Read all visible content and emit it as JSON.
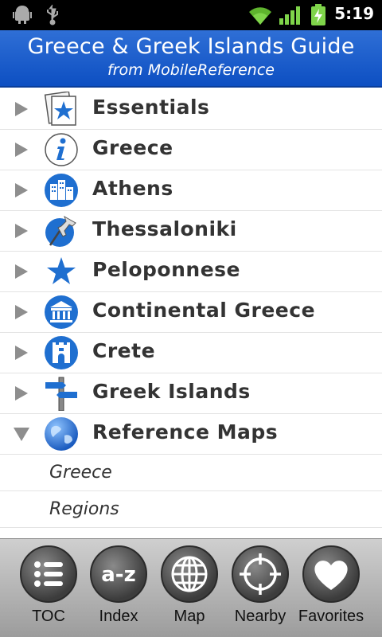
{
  "status_bar": {
    "time": "5:19",
    "icons": [
      "android-debug-icon",
      "usb-icon",
      "wifi-icon",
      "signal-icon",
      "battery-charging-icon"
    ]
  },
  "header": {
    "title": "Greece & Greek Islands Guide",
    "subtitle": "from MobileReference"
  },
  "toc": {
    "items": [
      {
        "label": "Essentials",
        "icon": "star-page-icon",
        "expanded": false
      },
      {
        "label": "Greece",
        "icon": "info-icon",
        "expanded": false
      },
      {
        "label": "Athens",
        "icon": "city-buildings-icon",
        "expanded": false
      },
      {
        "label": "Thessaloniki",
        "icon": "pushpin-icon",
        "expanded": false
      },
      {
        "label": "Peloponnese",
        "icon": "star-icon",
        "expanded": false
      },
      {
        "label": "Continental Greece",
        "icon": "temple-icon",
        "expanded": false
      },
      {
        "label": "Crete",
        "icon": "castle-tower-icon",
        "expanded": false
      },
      {
        "label": "Greek Islands",
        "icon": "signpost-icon",
        "expanded": false
      },
      {
        "label": "Reference Maps",
        "icon": "globe-icon",
        "expanded": true
      }
    ],
    "subitems": [
      {
        "label": "Greece"
      },
      {
        "label": "Regions"
      }
    ]
  },
  "bottom_nav": {
    "items": [
      {
        "label": "TOC",
        "icon": "list-icon"
      },
      {
        "label": "Index",
        "icon": "a-z-icon"
      },
      {
        "label": "Map",
        "icon": "globe-grid-icon"
      },
      {
        "label": "Nearby",
        "icon": "crosshair-icon"
      },
      {
        "label": "Favorites",
        "icon": "heart-icon"
      }
    ]
  },
  "colors": {
    "header_blue": "#1a5fd0",
    "icon_blue": "#1f6fd0",
    "text": "#333333"
  }
}
